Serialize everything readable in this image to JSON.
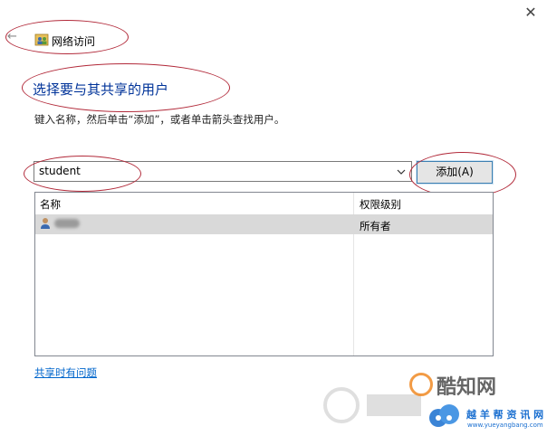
{
  "window": {
    "title": "网络访问",
    "close_glyph": "✕",
    "back_glyph": "←"
  },
  "main": {
    "heading": "选择要与其共享的用户",
    "instruction": "键入名称，然后单击“添加”，或者单击箭头查找用户。",
    "combo_value": "student",
    "add_button": "添加(A)"
  },
  "table": {
    "columns": [
      "名称",
      "权限级别"
    ],
    "rows": [
      {
        "name_redacted": true,
        "permission": "所有者"
      }
    ]
  },
  "footer": {
    "help_link": "共享时有问题"
  },
  "watermarks": {
    "brand1": "酷知网",
    "brand2": "越 羊 帮 资 讯 网",
    "brand2_url": "www.yueyangbang.com",
    "accent_orange": "#f08a24",
    "accent_blue": "#1a6fd0"
  },
  "annotation_color": "#b22a3a"
}
